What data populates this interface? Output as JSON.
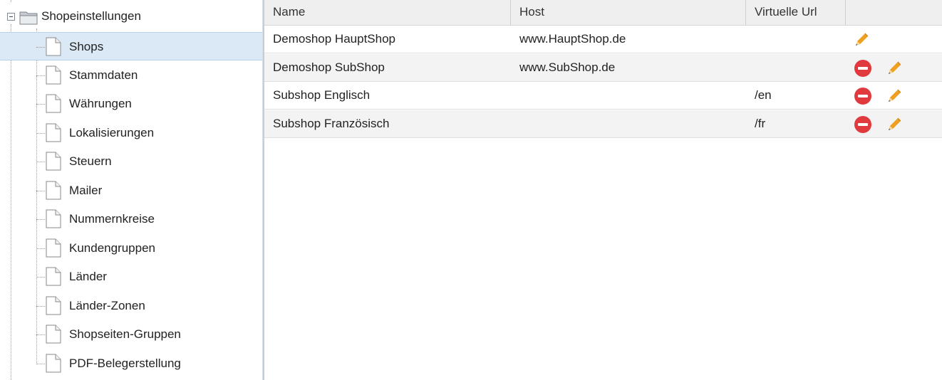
{
  "tree": {
    "root": {
      "label": "Shopeinstellungen",
      "expanded": true,
      "icon": "folder-icon"
    },
    "items": [
      {
        "label": "Shops",
        "selected": true,
        "icon": "document-icon"
      },
      {
        "label": "Stammdaten",
        "selected": false,
        "icon": "document-icon"
      },
      {
        "label": "Währungen",
        "selected": false,
        "icon": "document-icon"
      },
      {
        "label": "Lokalisierungen",
        "selected": false,
        "icon": "document-icon"
      },
      {
        "label": "Steuern",
        "selected": false,
        "icon": "document-icon"
      },
      {
        "label": "Mailer",
        "selected": false,
        "icon": "document-icon"
      },
      {
        "label": "Nummernkreise",
        "selected": false,
        "icon": "document-icon"
      },
      {
        "label": "Kundengruppen",
        "selected": false,
        "icon": "document-icon"
      },
      {
        "label": "Länder",
        "selected": false,
        "icon": "document-icon"
      },
      {
        "label": "Länder-Zonen",
        "selected": false,
        "icon": "document-icon"
      },
      {
        "label": "Shopseiten-Gruppen",
        "selected": false,
        "icon": "document-icon"
      },
      {
        "label": "PDF-Belegerstellung",
        "selected": false,
        "icon": "document-icon"
      }
    ]
  },
  "grid": {
    "columns": [
      "Name",
      "Host",
      "Virtuelle Url",
      ""
    ],
    "rows": [
      {
        "name": "Demoshop HauptShop",
        "host": "www.HauptShop.de",
        "virtual_url": "",
        "actions": [
          "edit-icon"
        ]
      },
      {
        "name": "Demoshop SubShop",
        "host": "www.SubShop.de",
        "virtual_url": "",
        "actions": [
          "delete-icon",
          "edit-icon"
        ]
      },
      {
        "name": "Subshop Englisch",
        "host": "",
        "virtual_url": "/en",
        "actions": [
          "delete-icon",
          "edit-icon"
        ]
      },
      {
        "name": "Subshop Französisch",
        "host": "",
        "virtual_url": "/fr",
        "actions": [
          "delete-icon",
          "edit-icon"
        ]
      }
    ]
  },
  "colors": {
    "selection": "#dbe9f6",
    "header_bg": "#efefef",
    "row_alt": "#f3f3f3",
    "delete_red": "#e0393e",
    "pencil_orange": "#f0a020"
  }
}
